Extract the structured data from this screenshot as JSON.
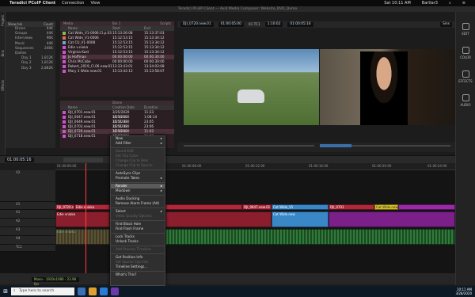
{
  "mac_menu": {
    "app": "Teradici PCoIP Client",
    "items": [
      "Connection",
      "View"
    ],
    "clock": "Sat 10:11 AM",
    "user": "Bartlar3"
  },
  "window": {
    "title": "Teradici PCoIP Client",
    "subtitle": "Avid Media Composer: Website_DVD_Demo"
  },
  "left_tabs": [
    "Project",
    "Bins",
    "Effects"
  ],
  "bins": {
    "header_left": "Show bin",
    "header_right": "Count",
    "items": [
      {
        "label": "Drone",
        "count": "64K"
      },
      {
        "label": "Groups",
        "count": "44K"
      },
      {
        "label": "Interviews",
        "count": "96K"
      },
      {
        "label": "Music",
        "count": "44K"
      },
      {
        "label": "Sequences",
        "count": "246K"
      },
      {
        "label": "Dailies",
        "count": ""
      },
      {
        "label": "Day 1",
        "count": "1,812K"
      },
      {
        "label": "Day 2",
        "count": "1,812K"
      },
      {
        "label": "Day 3",
        "count": "2,882K"
      }
    ]
  },
  "mediapool": {
    "tab_left": "Media",
    "tab_center": "Bin 1",
    "tab_right": "Scripts",
    "columns": [
      "",
      "Name",
      "Start",
      "End"
    ],
    "rows": [
      {
        "name": "Cat Wide_V1-0006.Cl.p.03",
        "start": "15:13:26:08",
        "end": "15:13:37:03"
      },
      {
        "name": "Cat Wide_V1-0006",
        "start": "15:12:53:15",
        "end": "15:13:34:12"
      },
      {
        "name": "Cat CU_V1-0008",
        "start": "15:12:53:15",
        "end": "15:13:34:12"
      },
      {
        "name": "Edie v.nioka",
        "start": "15:12:53:15",
        "end": "15:13:34:12"
      },
      {
        "name": "Virginia Kast",
        "start": "15:12:53:15",
        "end": "15:13:34:12"
      },
      {
        "name": "Jo Hoffman",
        "start": "00:00:00:00",
        "end": "00:00:30:00"
      },
      {
        "name": "Chris McCabe",
        "start": "00:00:00:00",
        "end": "00:00:30:00"
      },
      {
        "name": "Robert_2019_Cl.06.new.01",
        "start": "13:33:43:01",
        "end": "13:34:03:08"
      },
      {
        "name": "Mary 3 Wide.new.01",
        "start": "15:13:42:13",
        "end": "15:13:58:07"
      }
    ]
  },
  "clips2": {
    "tab": "Drone",
    "subtitle": "New Bin (New)",
    "columns": [
      "",
      "Name",
      "Creation Date",
      "Duration"
    ],
    "rows": [
      {
        "name": "DJI_0701.new.01",
        "date": "3/25/2020 15:30:10",
        "dur": "11:23"
      },
      {
        "name": "DJI_0647.new.01",
        "date": "3/25/2020 15:31:38",
        "dur": "1:08:14"
      },
      {
        "name": "DJI_0649.new.01",
        "date": "3/25/2020 15:31:38",
        "dur": "23:05"
      },
      {
        "name": "DJI_0703.new.01",
        "date": "3/25/2020 15:30:10",
        "dur": "23:06"
      },
      {
        "name": "DJI_0720.new.01",
        "date": "3/25/2020 15:30:15",
        "dur": "11:03"
      },
      {
        "name": "DJI_0718.new.01",
        "date": "3/25/2020 15:30:10",
        "dur": "11:03"
      }
    ]
  },
  "viewer": {
    "source_clip": "DJI_0720.new.01",
    "tc1": "01:00:05:00",
    "tc_label": "01 TC1",
    "tc_dur": "1:10:02",
    "tc_master": "01:00:05:16",
    "record_label": "Sins",
    "mark": "00"
  },
  "right_panel": [
    "EDIT",
    "COLOR",
    "EFFECTS",
    "AUDIO"
  ],
  "timeline": {
    "sequence_tc": "01:00:05:16",
    "ruler": [
      "01:00:00:00",
      "01:00:04:00",
      "01:00:08:00",
      "01:00:12:00",
      "01:00:16:00",
      "01:00:20:00",
      "01:00:24:00"
    ],
    "tracks": [
      "V2",
      "V1",
      "A1",
      "A2",
      "A3",
      "A4",
      "TC1"
    ],
    "clips": {
      "v1_a": "DJI_0720.new.01",
      "v1_b": "Edie vnioka",
      "v1_c": "DJI_0647.new.01",
      "v1_d": "Cat Wide_V1",
      "v1_e": "DJI_0701",
      "v1_f": "Cat Wide.new",
      "a_a": "Edie vnioka",
      "a_b": "Cat Wide.new",
      "a_c": "Edie vnioka"
    },
    "status": "Mono - 1920x1080 - 23.98 fps"
  },
  "context_menu": [
    {
      "label": "New",
      "sub": true
    },
    {
      "label": "Add Filter",
      "sub": true
    },
    {
      "sep": true
    },
    {
      "label": "Sound Edit",
      "dis": true
    },
    {
      "label": "Set Clip Color",
      "dis": true
    },
    {
      "label": "Change Clip to Reel",
      "dis": true
    },
    {
      "label": "Change Clip to Source",
      "dis": true
    },
    {
      "sep": true
    },
    {
      "label": "AutoSync Clips"
    },
    {
      "label": "Promote Takes",
      "sub": true
    },
    {
      "sep": true
    },
    {
      "label": "Render",
      "sub": true,
      "hl": true
    },
    {
      "label": "Mixdown",
      "sub": true
    },
    {
      "sep": true
    },
    {
      "label": "Audio Ducking"
    },
    {
      "label": "Remove Alarm Frame (Alt)"
    },
    {
      "sep": true
    },
    {
      "label": "Select",
      "sub": true
    },
    {
      "label": "Video Quality Options",
      "dis": true
    },
    {
      "sep": true
    },
    {
      "label": "Find Black Hole"
    },
    {
      "label": "Find Flash Frame"
    },
    {
      "sep": true
    },
    {
      "label": "Lock Tracks"
    },
    {
      "label": "Unlock Tracks"
    },
    {
      "sep": true
    },
    {
      "label": "Add Process Timeline",
      "dis": true
    },
    {
      "sep": true
    },
    {
      "label": "Get Position Info"
    },
    {
      "label": "Set Source Clip Info",
      "dis": true
    },
    {
      "label": "Timeline Settings..."
    },
    {
      "sep": true
    },
    {
      "label": "What's This?"
    }
  ],
  "taskbar": {
    "search": "Type here to search",
    "time": "10:11 AM",
    "date": "3/28/2020"
  }
}
